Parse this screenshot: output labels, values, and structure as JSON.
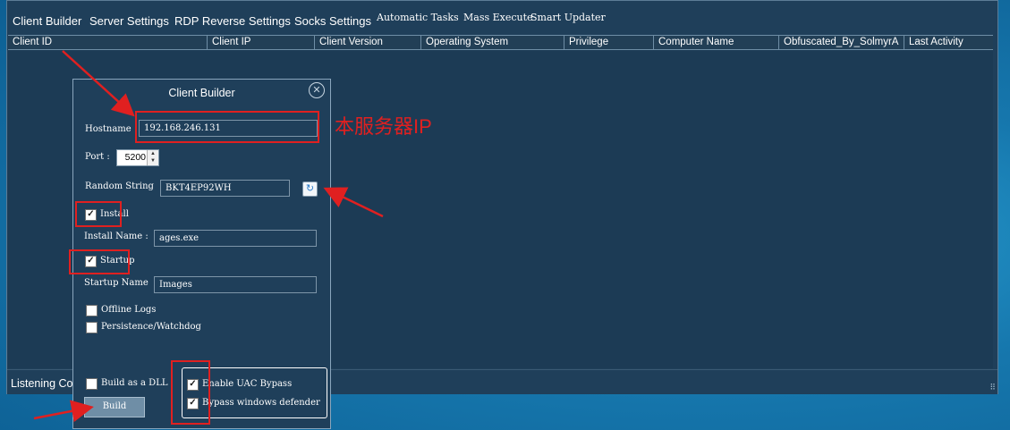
{
  "menu": {
    "client_builder": "Client Builder",
    "server_settings": "Server Settings",
    "rdp_reverse_settings": "RDP Reverse Settings",
    "socks_settings": "Socks Settings",
    "automatic_tasks": "Automatic Tasks",
    "mass_execute": "Mass Execute",
    "smart_updater": "Smart Updater"
  },
  "grid": {
    "columns": [
      "Client ID",
      "Client IP",
      "Client Version",
      "Operating System",
      "Privilege",
      "Computer Name",
      "Obfuscated_By_SolmyrA",
      "Last Activity"
    ]
  },
  "status": {
    "text": "Listening  Co"
  },
  "dialog": {
    "title": "Client Builder",
    "hostname_label": "Hostname",
    "hostname_value": "192.168.246.131",
    "port_label": "Port :",
    "port_value": "5200",
    "random_string_label": "Random String",
    "random_string_value": "BKT4EP92WH",
    "install_label": "Install",
    "install_checked": true,
    "install_name_label": "Install Name :",
    "install_name_value": "ages.exe",
    "startup_label": "Startup",
    "startup_checked": true,
    "startup_name_label": "Startup Name",
    "startup_name_value": "Images",
    "offline_logs_label": "Offline Logs",
    "offline_logs_checked": false,
    "persistence_label": "Persistence/Watchdog",
    "persistence_checked": false,
    "build_dll_label": "Build as a DLL",
    "build_dll_checked": false,
    "uac_bypass_label": "Enable UAC Bypass",
    "uac_bypass_checked": true,
    "defender_bypass_label": "Bypass windows defender",
    "defender_bypass_checked": true,
    "build_button": "Build"
  },
  "annotation": {
    "server_ip_note": "本服务器IP",
    "color": "#e02020"
  },
  "colors": {
    "window_bg": "#1f3f5a",
    "desktop_bg": "#1a7fb4"
  }
}
